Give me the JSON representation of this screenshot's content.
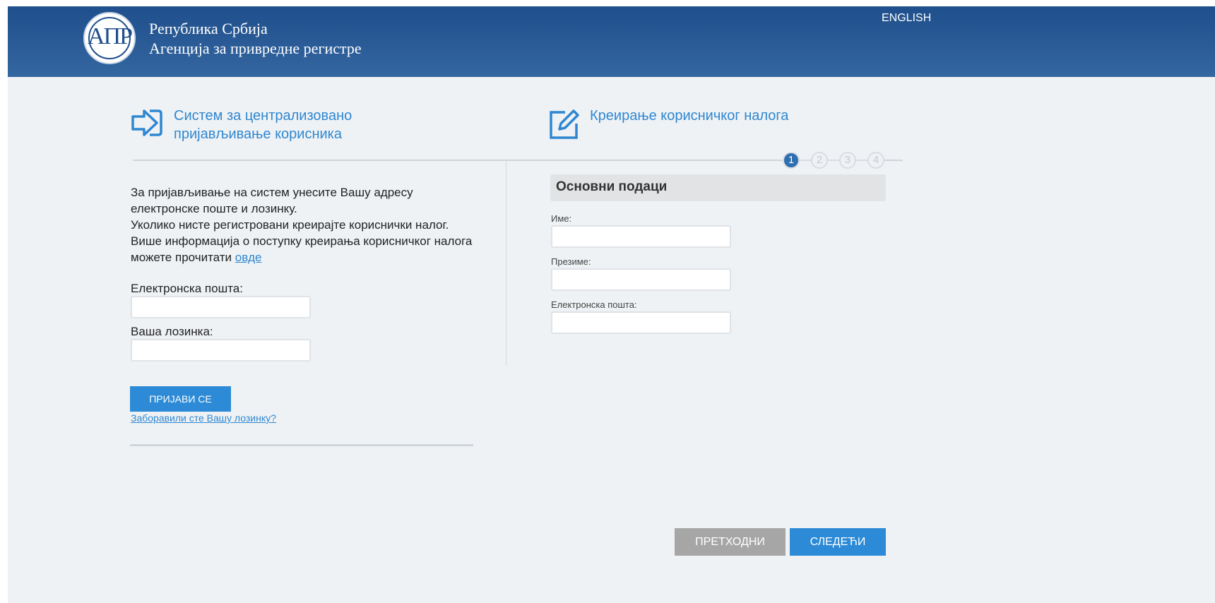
{
  "header": {
    "logo_text": "АПР",
    "org_line1": "Република Србија",
    "org_line2": "Агенција за привредне регистре",
    "language_link": "ENGLISH"
  },
  "login": {
    "title_line1": "Систем за централизовано",
    "title_line2": "пријављивање корисника",
    "intro_line1": "За пријављивање на систем унесите Вашу адресу",
    "intro_line2": "електронске поште и лозинку.",
    "intro_line3": "Уколико нисте регистровани креирајте кориснички налог.",
    "intro_line4": "Више информација о поступку креирања корисничког налога",
    "intro_line5": "можете прочитати",
    "intro_link": "овде",
    "email_label": "Електронска пошта:",
    "email_value": "",
    "password_label": "Ваша лозинка:",
    "password_value": "",
    "login_button": "ПРИЈАВИ СЕ",
    "forgot_link": "Заборавили сте Вашу лозинку?"
  },
  "register": {
    "title": "Креирање корисничког налога",
    "steps": [
      "1",
      "2",
      "3",
      "4"
    ],
    "active_step": 1,
    "section_title": "Основни подаци",
    "first_name_label": "Име:",
    "first_name_value": "",
    "last_name_label": "Презиме:",
    "last_name_value": "",
    "email_label": "Електронска пошта:",
    "email_value": "",
    "prev_button": "ПРЕТХОДНИ",
    "next_button": "СЛЕДЕЋИ"
  },
  "colors": {
    "header": "#1f4f8c",
    "accent": "#2c8ad6",
    "disabled_button": "#a6a6a6",
    "background": "#eff2f5"
  },
  "icons": {
    "login_icon": "sign-in-arrow-icon",
    "register_icon": "edit-pencil-icon"
  }
}
